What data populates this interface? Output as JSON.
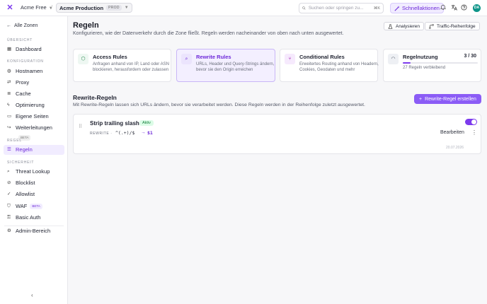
{
  "topbar": {
    "logo": "✕",
    "org_name": "Acme Free",
    "separator": "/",
    "zone_name": "Acme Production",
    "zone_badge": "PROD",
    "search_placeholder": "Suchen oder springen zu...",
    "search_shortcut": "⌘K",
    "quick_actions": "Schnellaktionen",
    "avatar_initials": "DA"
  },
  "sidebar": {
    "back": "Alle Zonen",
    "section_overview": "ÜBERSICHT",
    "section_config": "KONFIGURATION",
    "section_rules": "REGEL",
    "section_security": "SICHERHEIT",
    "items": {
      "dashboard": "Dashboard",
      "hostnames": "Hostnamen",
      "proxy": "Proxy",
      "cache": "Cache",
      "optimization": "Optimierung",
      "custom_pages": "Eigene Seiten",
      "redirects": "Weiterleitungen",
      "redirects_badge": "BETA",
      "rules": "Regeln",
      "threat_lookup": "Threat Lookup",
      "blocklist": "Blocklist",
      "allowlist": "Allowlist",
      "waf": "WAF",
      "waf_badge": "BETA",
      "basic_auth": "Basic Auth",
      "admin": "Admin-Bereich"
    }
  },
  "main": {
    "title": "Regeln",
    "subtitle": "Konfigurieren, wie der Datenverkehr durch die Zone fließt. Regeln werden nacheinander von oben nach unten ausgewertet.",
    "analyze_label": "Analysieren",
    "order_label": "Traffic-Reihenfolge",
    "cards": {
      "access": {
        "title": "Access Rules",
        "desc": "Anfragen anhand von IP, Land oder ASN blockieren, herausfordern oder zulassen"
      },
      "rewrite": {
        "title": "Rewrite Rules",
        "desc": "URLs, Header und Query-Strings ändern, bevor sie den Origin erreichen"
      },
      "conditional": {
        "title": "Conditional Rules",
        "desc": "Erweitertes Routing anhand von Headern, Cookies, Geodaten und mehr"
      },
      "usage": {
        "title": "Regelnutzung",
        "count": "3 / 30",
        "remaining": "27 Regeln verbleibend",
        "used": 3,
        "max": 30
      }
    },
    "section_title": "Rewrite-Regeln",
    "section_sub": "Mit Rewrite-Regeln lassen sich URLs ändern, bevor sie verarbeitet werden. Diese Regeln werden in der Reihenfolge zuletzt ausgewertet.",
    "create_label": "Rewrite-Regel erstellen",
    "rule": {
      "name": "Strip trailing slash",
      "status": "Aktiv",
      "type": "REWRITE",
      "type_sep": "·",
      "pattern": "^(.+)/$",
      "arrow": "→",
      "replacement": "$1",
      "edit_label": "Bearbeiten",
      "date": "20.07.2026"
    }
  },
  "colors": {
    "accent": "#7c3aed",
    "success": "#15803d"
  }
}
